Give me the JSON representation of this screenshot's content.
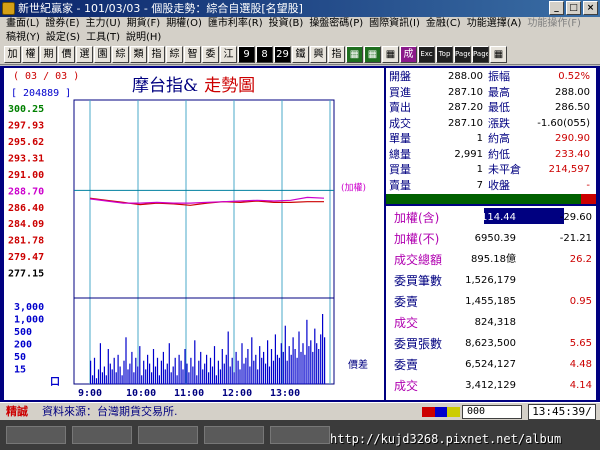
{
  "window": {
    "title": "新世紀贏家 - 101/03/03 - 個股走勢：綜合自選股[名望股]",
    "controls": [
      "_",
      "□",
      "×"
    ]
  },
  "menu1": [
    "畫面(L)",
    "證券(E)",
    "主力(U)",
    "期貨(F)",
    "期權(O)",
    "匯市利率(R)",
    "投資(B)",
    "操盤密碼(P)",
    "國際資訊(I)",
    "金融(C)",
    "功能選擇(A)",
    "功能操作(F)"
  ],
  "menu2": [
    "稿視(Y)",
    "設定(S)",
    "工具(T)",
    "說明(H)"
  ],
  "toolbar": [
    "加",
    "權",
    "期",
    "價",
    "選",
    "園",
    "綜",
    "類",
    "指",
    "綜",
    "智",
    "委",
    "江",
    "9",
    "8",
    "29",
    "鐵",
    "興",
    "指",
    "▦",
    "▦",
    "▦",
    "成",
    "Exc",
    "Top",
    "Page",
    "Page",
    "▦"
  ],
  "chart_data": {
    "type": "line",
    "code": "( 03 / 03 )",
    "id": "[ 204889 ]",
    "title": "摩台指&",
    "title2": "走勢圖",
    "y_ticks": [
      "300.25",
      "297.93",
      "295.62",
      "293.31",
      "291.00",
      "288.70",
      "286.40",
      "284.09",
      "281.78",
      "279.47",
      "277.15"
    ],
    "y_tick_colors": [
      "#008000",
      "#cc0000",
      "#cc0000",
      "#cc0000",
      "#cc0000",
      "#cc00cc",
      "#cc0000",
      "#cc0000",
      "#cc0000",
      "#cc0000",
      "#000000"
    ],
    "volume_ticks": [
      "3,000",
      "1,000",
      "500",
      "200",
      "50",
      "15",
      "口"
    ],
    "x_ticks": [
      "9:00",
      "10:00",
      "11:00",
      "12:00",
      "13:00"
    ],
    "ylim": [
      277.15,
      300.25
    ],
    "ref_price": 288.7,
    "ref_label": "(加權)",
    "diff_label": "價差",
    "series": [
      {
        "name": "摩台指",
        "color": "#cc0000",
        "values": [
          287.6,
          287.3,
          287.0,
          286.7,
          286.9,
          286.8,
          286.6,
          286.9,
          287.1,
          287.0,
          287.2,
          287.0,
          287.0,
          287.1,
          287.1
        ]
      },
      {
        "name": "加權",
        "color": "#cc00cc",
        "values": [
          287.5,
          287.2,
          286.9,
          286.9,
          287.0,
          286.9,
          286.9,
          287.0,
          287.1,
          287.2,
          287.3,
          287.2,
          287.3,
          287.7,
          287.6
        ]
      }
    ],
    "volume": [
      8,
      3,
      9,
      2,
      5,
      14,
      4,
      6,
      3,
      12,
      7,
      5,
      9,
      4,
      10,
      6,
      3,
      8,
      16,
      5,
      7,
      11,
      4,
      9,
      6,
      13,
      3,
      8,
      5,
      10,
      7,
      4,
      12,
      6,
      9,
      3,
      8,
      11,
      5,
      7,
      14,
      4,
      6,
      9,
      3,
      10,
      8,
      5,
      12,
      7,
      4,
      9,
      6,
      15,
      3,
      8,
      11,
      5,
      7,
      10,
      4,
      9,
      6,
      13,
      3,
      8,
      5,
      12,
      7,
      10,
      18,
      6,
      9,
      4,
      11,
      8,
      5,
      14,
      7,
      9,
      12,
      6,
      16,
      8,
      10,
      5,
      13,
      9,
      11,
      7,
      15,
      6,
      12,
      8,
      17,
      10,
      9,
      14,
      11,
      20,
      8,
      13,
      10,
      16,
      12,
      9,
      18,
      11,
      14,
      10,
      22,
      13,
      15,
      11,
      19,
      14,
      12,
      17,
      24,
      16
    ]
  },
  "quote": [
    {
      "l1": "開盤",
      "v1": "288.00",
      "l2": "振幅",
      "v2": "0.52%",
      "c2": "red"
    },
    {
      "l1": "買進",
      "v1": "287.10",
      "l2": "最高",
      "v2": "288.00",
      "c2": "blk"
    },
    {
      "l1": "賣出",
      "v1": "287.20",
      "l2": "最低",
      "v2": "286.50",
      "c2": "blk"
    },
    {
      "l1": "成交",
      "v1": "287.10",
      "l2": "漲跌",
      "v2": "-1.60(055)",
      "c2": "blk"
    },
    {
      "l1": "單量",
      "v1": "1",
      "l2": "約高",
      "v2": "290.90",
      "c2": "red"
    },
    {
      "l1": "總量",
      "v1": "2,991",
      "l2": "約低",
      "v2": "233.40",
      "c2": "red"
    },
    {
      "l1": "買量",
      "v1": "1",
      "l2": "未平倉",
      "v2": "214,597",
      "c2": "red"
    },
    {
      "l1": "賣量",
      "v1": "7",
      "l2": "收盤",
      "v2": "-",
      "c2": "red"
    }
  ],
  "indices": [
    {
      "label": "加權(含)",
      "value": "8114.44",
      "change": "-29.60",
      "lc": "mag",
      "cc": "blk",
      "hl": true
    },
    {
      "label": "加權(不)",
      "value": "6950.39",
      "change": "-21.21",
      "lc": "mag",
      "cc": "blk"
    },
    {
      "label": "成交總額",
      "value": "895.18億",
      "change": "26.2",
      "lc": "mag",
      "cc": "red"
    },
    {
      "label": "委買筆數",
      "value": "1,526,179",
      "change": "",
      "lc": "",
      "cc": "blk"
    },
    {
      "label": "委賣",
      "value": "1,455,185",
      "change": "0.95",
      "lc": "",
      "cc": "red"
    },
    {
      "label": "成交",
      "value": "824,318",
      "change": "",
      "lc": "mag",
      "cc": "blk"
    },
    {
      "label": "委買張數",
      "value": "8,623,500",
      "change": "5.65",
      "lc": "",
      "cc": "red"
    },
    {
      "label": "委賣",
      "value": "6,524,127",
      "change": "4.48",
      "lc": "",
      "cc": "red"
    },
    {
      "label": "成交",
      "value": "3,412,129",
      "change": "4.14",
      "lc": "mag",
      "cc": "red"
    }
  ],
  "status": {
    "mode": "精誠",
    "source": "資料來源：台灣期貨交易所.",
    "code_input": "000",
    "clock": "13:45:39/",
    "watermark": "http://kujd3268.pixnet.net/album"
  }
}
